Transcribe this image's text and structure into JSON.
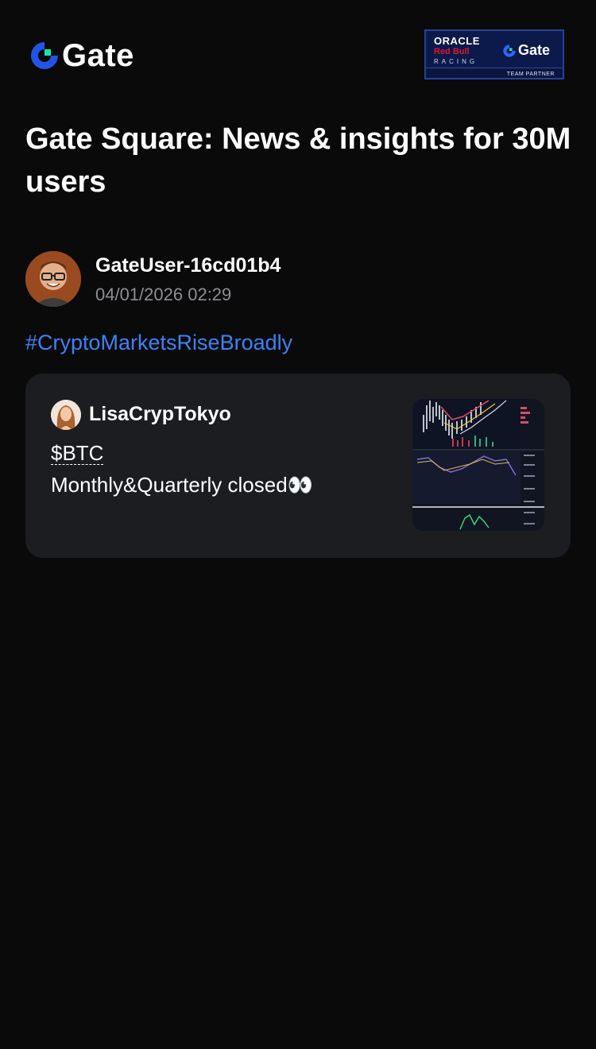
{
  "header": {
    "brand": "Gate",
    "partner": {
      "oracle": "ORACLE",
      "redbull": "Red Bull",
      "racing": "RACING",
      "gate": "Gate",
      "label": "TEAM PARTNER"
    }
  },
  "page": {
    "title": "Gate Square: News & insights for 30M users"
  },
  "post": {
    "author": "GateUser-16cd01b4",
    "timestamp": "04/01/2026 02:29",
    "hashtag": "#CryptoMarketsRiseBroadly"
  },
  "quote": {
    "author": "LisaCrypTokyo",
    "ticker": "$BTC",
    "text": "Monthly&Quarterly closed👀"
  },
  "icons": {
    "brand_logo": "gate-logo-icon",
    "eyes": "eyes-emoji"
  },
  "colors": {
    "background": "#0a0a0b",
    "card": "#1c1d21",
    "hashtag": "#3b82f6",
    "brand_blue": "#2354e6",
    "brand_green": "#17e6a1"
  }
}
